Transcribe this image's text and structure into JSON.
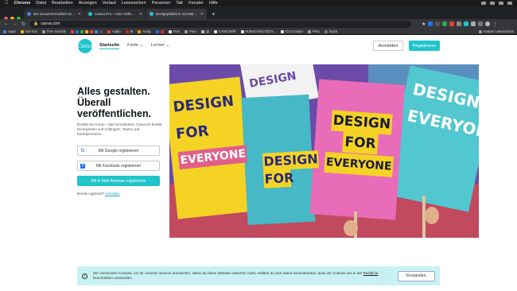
{
  "menubar": {
    "app": "Chrome",
    "items": [
      "Datei",
      "Bearbeiten",
      "Anzeigen",
      "Verlauf",
      "Lesezeichen",
      "Personen",
      "Tab",
      "Fenster",
      "Hilfe"
    ]
  },
  "tabs": [
    {
      "title": "Die Zusammenarbeit und das V",
      "active": false
    },
    {
      "title": "Canva Pro – eine Online-Tool für",
      "active": false
    },
    {
      "title": "Designplattform mit Markenkon",
      "active": true
    }
  ],
  "address": {
    "url": "canva.com"
  },
  "bookmarks": {
    "items": [
      "Apps",
      "Get Koo",
      "Free Sounds",
      "Audio",
      "M",
      "Analy",
      "Font",
      "Pma",
      "CAMCOMP",
      "#UNSCHGUTSCH...",
      "ICS Creator",
      "Pma",
      "Stock"
    ],
    "other": "Andere Lesezeichen"
  },
  "header": {
    "logo_text": "Canva",
    "nav": [
      {
        "label": "Startseite",
        "active": true
      },
      {
        "label": "Finde ⌄",
        "active": false
      },
      {
        "label": "Lernen ⌄",
        "active": false
      }
    ],
    "login_label": "Anmelden",
    "register_label": "Registrieren"
  },
  "hero": {
    "headline": "Alles gestalten. Überall veröffentlichen.",
    "description": "Erstelle ein Konto – das ist kostenlos. Canva ist beliebt bei Experten und Anfängern, Teams und Einzelpersonen.",
    "google_label": "Mit Google registrieren",
    "facebook_label": "Mit Facebook registrieren",
    "email_label": "Mit E-Mail-Adresse registrieren",
    "already_text": "Bereits registriert?",
    "already_link": "Anmelden",
    "sign_words": [
      "DESIGN",
      "FOR",
      "EVERYONE"
    ]
  },
  "cookie": {
    "text": "Wir verwenden Cookies, um dir unseren Service anzubieten. Wenn du diese Website weiterhin nutzt, erklärst du dich damit einverstanden, dass wir Cookies wie in der",
    "link": "Richtlinie",
    "text_after": "beschrieben verwenden.",
    "accept_label": "Verstanden."
  },
  "colors": {
    "brand": "#20c4cb",
    "chrome_dark": "#202124"
  }
}
